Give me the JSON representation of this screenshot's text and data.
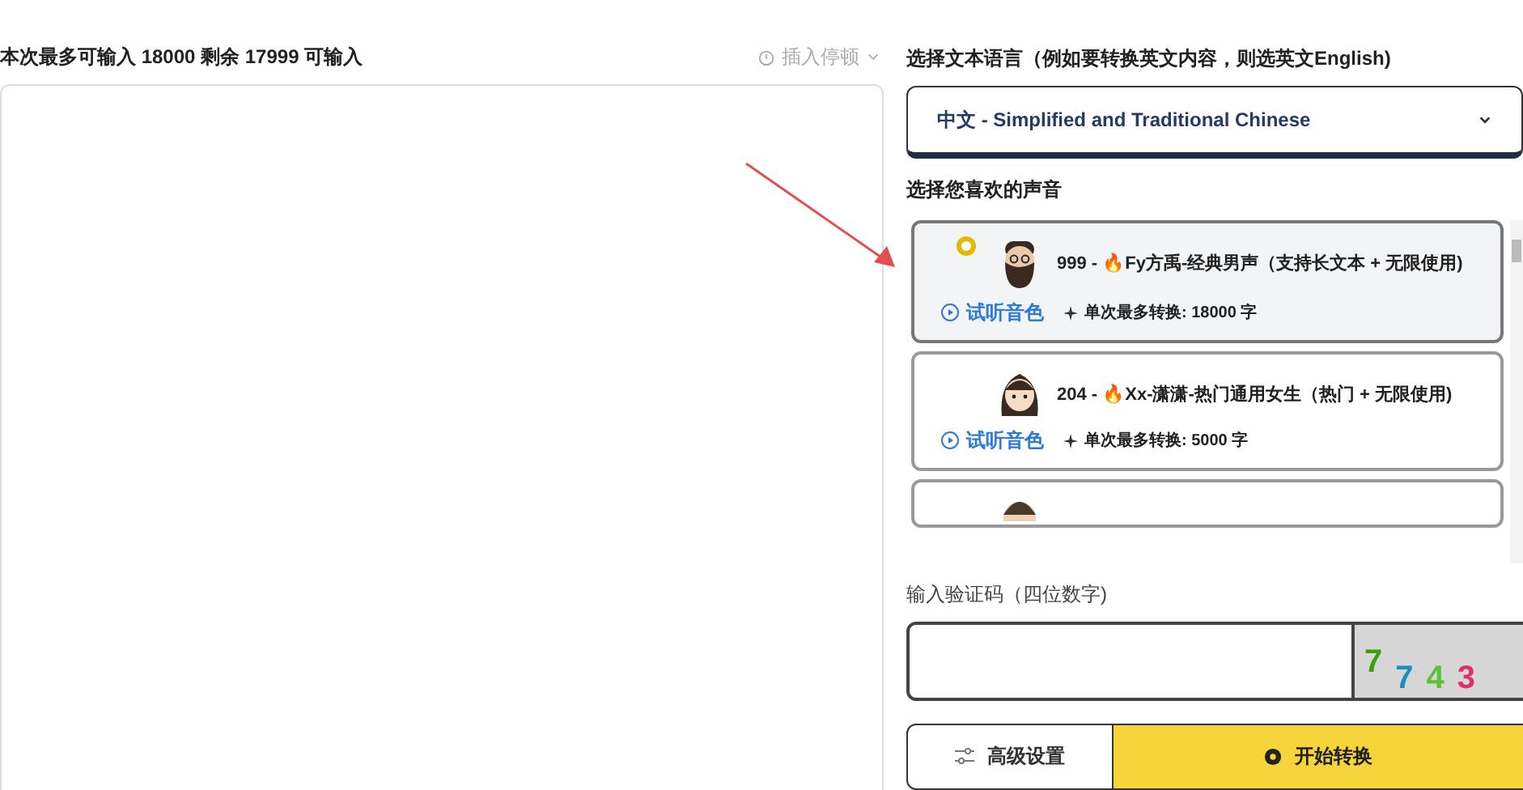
{
  "input_panel": {
    "counter": "本次最多可输入 18000 剩余 17999 可输入",
    "pause_menu": "插入停顿"
  },
  "language": {
    "label": "选择文本语言（例如要转换英文内容，则选英文English)",
    "value_bold": "中文",
    "value_rest": " - Simplified and Traditional Chinese"
  },
  "voices": {
    "label": "选择您喜欢的声音",
    "items": [
      {
        "selected": true,
        "kind": "bearded-man",
        "title": "999 - 🔥Fy方禹-经典男声（支持长文本 + 无限使用)",
        "preview": "试听音色",
        "limit": "单次最多转换: 18000 字"
      },
      {
        "selected": false,
        "kind": "girl",
        "title": "204 - 🔥Xx-潇潇-热门通用女生（热门 + 无限使用)",
        "preview": "试听音色",
        "limit": "单次最多转换: 5000 字"
      },
      {
        "selected": false,
        "kind": "man"
      }
    ]
  },
  "captcha": {
    "label": "输入验证码（四位数字)",
    "digits": [
      {
        "text": "7",
        "color": "#3aa010"
      },
      {
        "text": "7",
        "color": "#1a8fc0"
      },
      {
        "text": "4",
        "color": "#5cc23a"
      },
      {
        "text": "3",
        "color": "#e0306a"
      }
    ]
  },
  "buttons": {
    "advanced": "高级设置",
    "start": "开始转换"
  }
}
